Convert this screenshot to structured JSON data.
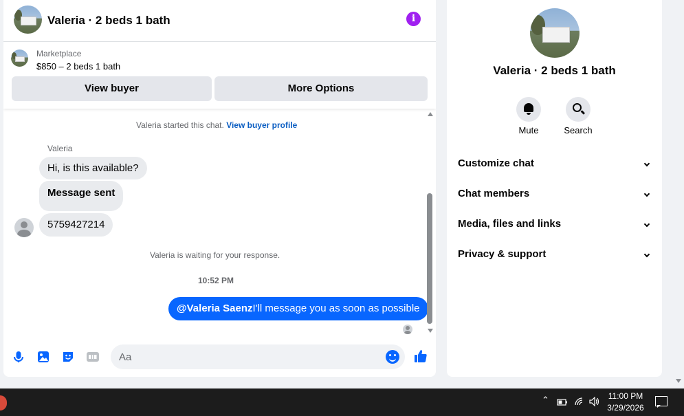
{
  "chat": {
    "title": "Valeria · 2 beds 1 bath",
    "listing": {
      "source": "Marketplace",
      "price_line": "$850 – 2 beds 1 bath",
      "view_buyer": "View buyer",
      "more_options": "More Options"
    },
    "system_start": "Valeria started this chat.",
    "view_profile_link": "View buyer profile",
    "sender_name": "Valeria",
    "incoming": [
      "Hi, is this available?",
      "Message sent",
      "5759427214"
    ],
    "waiting_text": "Valeria is waiting for your response.",
    "timestamp": "10:52 PM",
    "outgoing_mention": "@Valeria Saenz",
    "outgoing_text": "I'll message you as soon as possible",
    "input_placeholder": "Aa"
  },
  "side": {
    "title": "Valeria · 2 beds 1 bath",
    "actions": {
      "mute": "Mute",
      "search": "Search"
    },
    "sections": [
      "Customize chat",
      "Chat members",
      "Media, files and links",
      "Privacy & support"
    ]
  },
  "taskbar": {
    "time": "11:00 PM",
    "date": "3/29/2026"
  },
  "colors": {
    "accent": "#0866ff",
    "info_button": "#a020f0",
    "bubble_incoming": "#e9ebee"
  }
}
